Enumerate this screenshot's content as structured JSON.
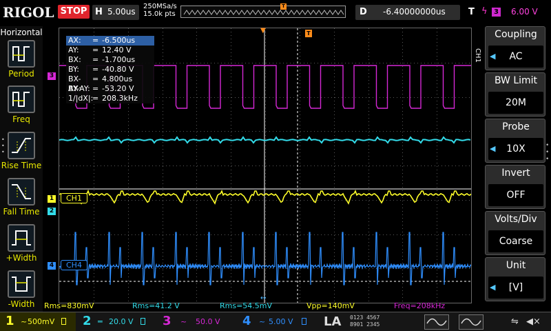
{
  "header": {
    "logo": "RIGOL",
    "run_state": "STOP",
    "timebase_letter": "H",
    "timebase": "5.00us",
    "sample_rate": "250MSa/s",
    "memory_depth": "15.0k pts",
    "delay_letter": "D",
    "delay": "-6.40000000us",
    "trigger_letter": "T",
    "trigger_source": "3",
    "trigger_level": "6.00 V"
  },
  "left_panel": {
    "title": "Horizontal",
    "buttons": [
      {
        "label": "Period",
        "icon": "period-icon"
      },
      {
        "label": "Freq",
        "icon": "frequency-icon"
      },
      {
        "label": "Rise Time",
        "icon": "rise-time-icon"
      },
      {
        "label": "Fall Time",
        "icon": "fall-time-icon"
      },
      {
        "label": "+Width",
        "icon": "positive-width-icon"
      },
      {
        "label": "-Width",
        "icon": "negative-width-icon"
      }
    ]
  },
  "right_panel": {
    "channel_tag": "CH1",
    "menu": [
      {
        "title": "Coupling",
        "value": "AC"
      },
      {
        "title": "BW Limit",
        "value": "20M"
      },
      {
        "title": "Probe",
        "value": "10X"
      },
      {
        "title": "Invert",
        "value": "OFF"
      },
      {
        "title": "Volts/Div",
        "value": "Coarse"
      },
      {
        "title": "Unit",
        "value": "[V]"
      }
    ]
  },
  "cursors": [
    {
      "name": "AX:",
      "eq": "=",
      "value": "-6.500us",
      "selected": true
    },
    {
      "name": "AY:",
      "eq": "=",
      "value": "12.40 V"
    },
    {
      "name": "BX:",
      "eq": "=",
      "value": "-1.700us"
    },
    {
      "name": "BY:",
      "eq": "=",
      "value": "-40.80 V"
    },
    {
      "name": "BX-AX:",
      "eq": "=",
      "value": "4.800us"
    },
    {
      "name": "BY-AY:",
      "eq": "=",
      "value": "-53.20 V"
    },
    {
      "name": "1/|dX|:",
      "eq": "=",
      "value": "208.3kHz"
    }
  ],
  "channel_labels": {
    "ch1": "CH1",
    "ch4": "CH4",
    "marker1": "1",
    "marker2": "2",
    "marker3": "3",
    "marker4": "4"
  },
  "measurements": [
    {
      "text": "Rms=830mV",
      "color": "#ffff2a"
    },
    {
      "text": "Rms=41.2 V",
      "color": "#33dcea"
    },
    {
      "text": "Rms=54.5mV",
      "color": "#33dcea"
    },
    {
      "text": "Vpp=140mV",
      "color": "#ffff2a"
    },
    {
      "text": "Freq=208kHz",
      "color": "#d628d6"
    }
  ],
  "channels_bar": [
    {
      "num": "1",
      "value": "500mV",
      "color": "#ffff2a",
      "bg": "#2a2a00"
    },
    {
      "num": "2",
      "value": "20.0 V",
      "color": "#33dcea",
      "bg": "#002226"
    },
    {
      "num": "3",
      "value": "50.0 V",
      "color": "#d628d6",
      "bg": "#1f001f"
    },
    {
      "num": "4",
      "value": "5.00 V",
      "color": "#2f8fff",
      "bg": "#001c33"
    }
  ],
  "la": {
    "label": "LA",
    "bits_top": "0123 4567",
    "bits_bottom": "8901 2345"
  },
  "colors": {
    "ch1": "#ffff2a",
    "ch2": "#33dcea",
    "ch3": "#d628d6",
    "ch4": "#2f8fff",
    "trigger": "#ff8c1a",
    "cursor_selected": "#2d5fa4"
  }
}
